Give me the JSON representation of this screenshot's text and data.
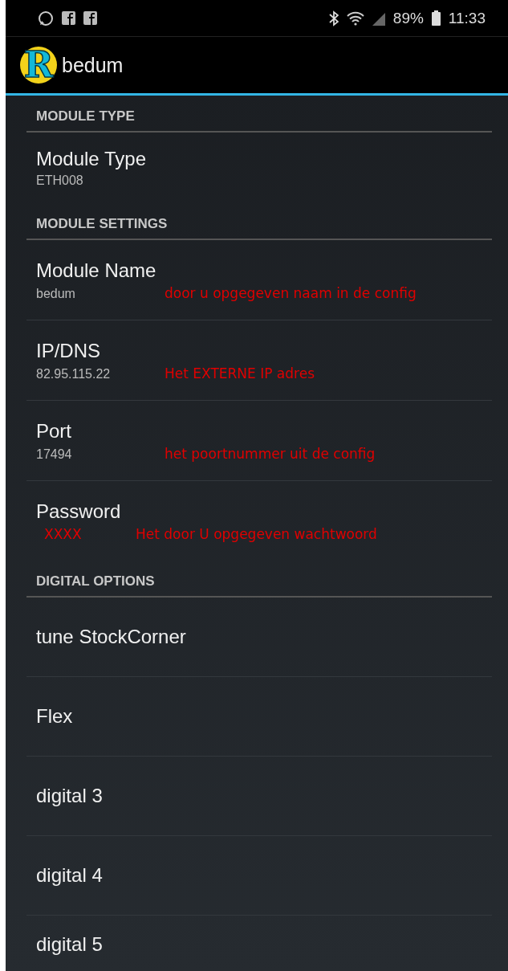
{
  "status_bar": {
    "battery": "89%",
    "time": "11:33"
  },
  "app_bar": {
    "logo_text": "R",
    "title": "bedum"
  },
  "sections": [
    {
      "header": "MODULE TYPE",
      "items": [
        {
          "title": "Module Type",
          "summary": "ETH008"
        }
      ]
    },
    {
      "header": "MODULE SETTINGS",
      "items": [
        {
          "title": "Module Name",
          "summary": "bedum",
          "notes": [
            "door u opgegeven naam in de config"
          ]
        },
        {
          "title": "IP/DNS",
          "summary": "82.95.115.22",
          "notes": [
            "Het EXTERNE IP adres"
          ]
        },
        {
          "title": "Port",
          "summary": "17494",
          "notes": [
            "het poortnummer uit de config"
          ]
        },
        {
          "title": "Password",
          "notes": [
            "XXXX",
            "Het door U opgegeven wachtwoord"
          ]
        }
      ]
    },
    {
      "header": "DIGITAL OPTIONS",
      "items": [
        {
          "title": "tune StockCorner"
        },
        {
          "title": "Flex"
        },
        {
          "title": "digital 3"
        },
        {
          "title": "digital 4"
        },
        {
          "title": "digital 5"
        }
      ]
    }
  ]
}
